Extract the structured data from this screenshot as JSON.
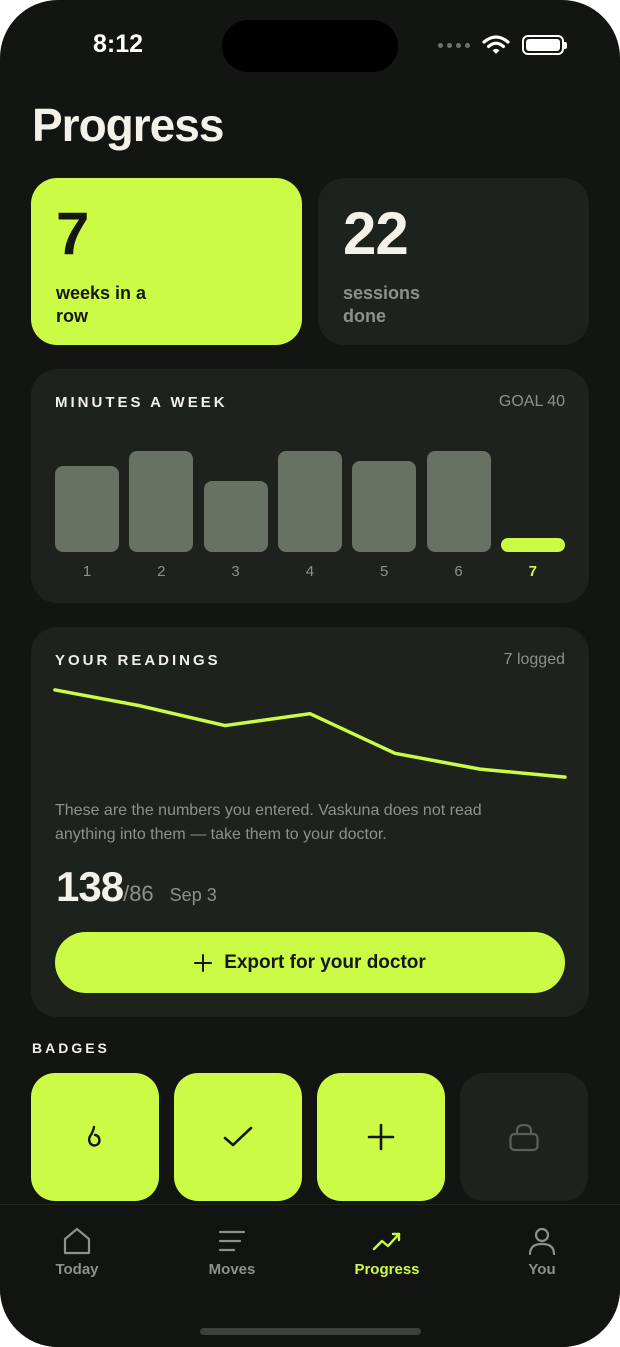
{
  "status": {
    "time": "8:12"
  },
  "page": {
    "title": "Progress"
  },
  "stats": [
    {
      "value": "7",
      "label": "weeks in a row"
    },
    {
      "value": "22",
      "label": "sessions done"
    }
  ],
  "minutes": {
    "title": "MINUTES A WEEK",
    "goal_label": "GOAL 40"
  },
  "readings": {
    "title": "YOUR READINGS",
    "count_label": "7 logged",
    "disclaimer": "These are the numbers you entered. Vaskuna does not read anything into them — take them to your doctor.",
    "latest_systolic": "138",
    "latest_diastolic": "/86",
    "latest_date": "Sep 3",
    "export_label": "Export for your doctor"
  },
  "badges": {
    "title": "BADGES",
    "items": [
      {
        "icon": "drop-icon",
        "earned": true
      },
      {
        "icon": "check-icon",
        "earned": true
      },
      {
        "icon": "plus-icon",
        "earned": true
      },
      {
        "icon": "lock-icon",
        "earned": false
      }
    ]
  },
  "tabs": [
    {
      "label": "Today",
      "icon": "home-icon",
      "active": false
    },
    {
      "label": "Moves",
      "icon": "list-icon",
      "active": false
    },
    {
      "label": "Progress",
      "icon": "trend-icon",
      "active": true
    },
    {
      "label": "You",
      "icon": "person-icon",
      "active": false
    }
  ],
  "colors": {
    "accent": "#cbfb45",
    "background": "#121511",
    "card": "#1d221c",
    "bar": "#677265"
  },
  "chart_data": [
    {
      "type": "bar",
      "title": "MINUTES A WEEK",
      "categories": [
        "1",
        "2",
        "3",
        "4",
        "5",
        "6",
        "7"
      ],
      "values": [
        34,
        40,
        28,
        40,
        36,
        40,
        2
      ],
      "highlight_index": 6,
      "goal": 40,
      "ylim": [
        0,
        40
      ],
      "grid": false
    },
    {
      "type": "line",
      "title": "YOUR READINGS",
      "x": [
        1,
        2,
        3,
        4,
        5,
        6,
        7
      ],
      "values": [
        152,
        148,
        143,
        146,
        136,
        132,
        130
      ],
      "ylim": [
        128,
        154
      ],
      "grid": false
    }
  ]
}
